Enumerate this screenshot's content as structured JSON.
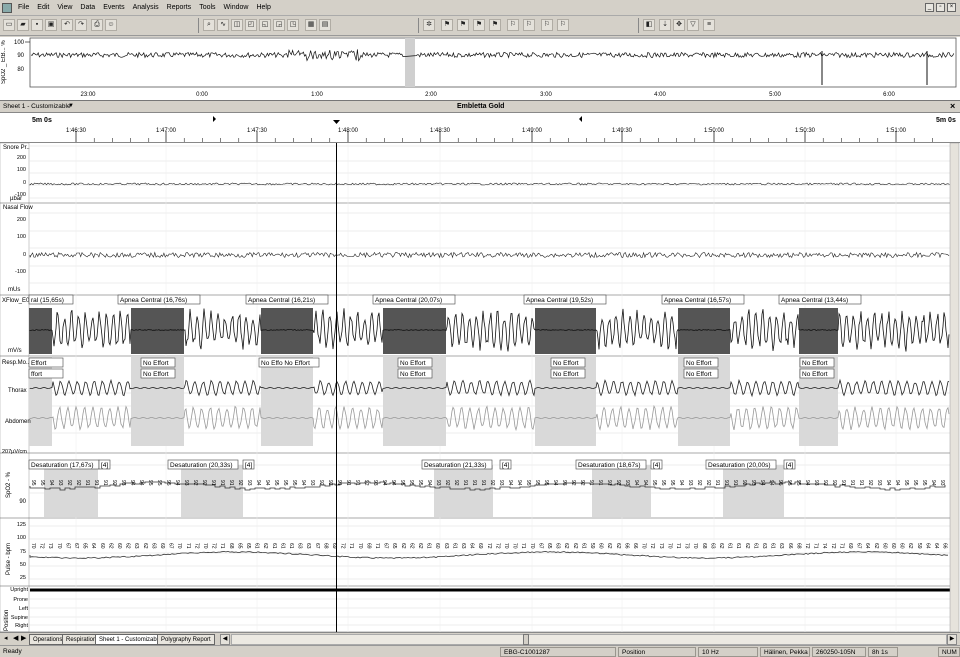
{
  "menu": [
    "File",
    "Edit",
    "View",
    "Data",
    "Events",
    "Analysis",
    "Reports",
    "Tools",
    "Window",
    "Help"
  ],
  "overview": {
    "ylabel": "SpO2 _ EtB... %",
    "yticks": [
      "100",
      "90",
      "80"
    ],
    "times": [
      "23:00",
      "0:00",
      "1:00",
      "2:00",
      "3:00",
      "4:00",
      "5:00",
      "6:00"
    ]
  },
  "sheet": {
    "name": "Sheet 1 - Customizable",
    "title": "Embletta Gold",
    "close": "×"
  },
  "timebar": {
    "span_left": "5m 0s",
    "span_right": "5m 0s",
    "ticks": [
      "1:46:30",
      "1:47:00",
      "1:47:30",
      "1:48:00",
      "1:48:30",
      "1:49:00",
      "1:49:30",
      "1:50:00",
      "1:50:30",
      "1:51:00"
    ]
  },
  "channels": {
    "snore": {
      "label": "Snore Pr..",
      "unit": "µbar",
      "ticks": [
        "200",
        "100",
        "0",
        "-100",
        "-200"
      ]
    },
    "nasal": {
      "label": "Nasal Flow",
      "unit": "mUs",
      "ticks": [
        "200",
        "100",
        "0",
        "-100",
        "-200"
      ]
    },
    "xflow": {
      "label": "XFlow_E0",
      "unit": "mV/s"
    },
    "resp": {
      "label": "Resp.Mo...",
      "thorax": "Thorax",
      "abdomen": "Abdomen",
      "unit": "207µV/cm"
    },
    "spo2": {
      "label": "SpO2 - %",
      "ticks": [
        "90"
      ]
    },
    "pulse": {
      "label": "Pulse - bpm",
      "ticks": [
        "125",
        "100",
        "75",
        "50",
        "25"
      ]
    },
    "position": {
      "label": "Position",
      "items": [
        "Upright",
        "Prone",
        "Left",
        "Supine",
        "Right",
        "Up..."
      ]
    }
  },
  "apnea_events": [
    {
      "label": "ral (15,65s)"
    },
    {
      "label": "Apnea Central (16,76s)"
    },
    {
      "label": "Apnea Central (16,21s)"
    },
    {
      "label": "Apnea Central (20,07s)"
    },
    {
      "label": "Apnea Central (19,52s)"
    },
    {
      "label": "Apnea Central (16,57s)"
    },
    {
      "label": "Apnea Central (13,44s)"
    }
  ],
  "effort_events": [
    {
      "top": "Effort",
      "bottom": "ffort"
    },
    {
      "top": "No Effort",
      "bottom": "No Effort"
    },
    {
      "top": "No Effo No Effort",
      "bottom": ""
    },
    {
      "top": "No Effort",
      "bottom": "No Effort"
    },
    {
      "top": "No Effort",
      "bottom": "No Effort"
    },
    {
      "top": "No Effort",
      "bottom": "No Effort"
    },
    {
      "top": "No Effort",
      "bottom": "No Effort"
    }
  ],
  "desat_events": [
    {
      "label": "Desaturation (17,67s)",
      "tag": "[4]"
    },
    {
      "label": "Desaturation (20,33s)",
      "tag": "[4]"
    },
    {
      "label": "Desaturation (21,33s)",
      "tag": "[4]"
    },
    {
      "label": "Desaturation (18,67s)",
      "tag": "[4]"
    },
    {
      "label": "Desaturation (20,00s)",
      "tag": "[4]"
    }
  ],
  "tabs": [
    "Operations",
    "Respiration",
    "Sheet 1 - Customizable",
    "Polygraphy Report"
  ],
  "status": {
    "ready": "Ready",
    "recording": "EBG-C1001287",
    "field": "Position",
    "rate": "10 Hz",
    "patient": "Hälinen, Pekka",
    "id": "260250-105N",
    "duration": "8h 1s",
    "num": "NUM"
  },
  "colors": {
    "grey": "#d9d9d9",
    "dark": "#555555",
    "selection": "#c8c8c8"
  }
}
